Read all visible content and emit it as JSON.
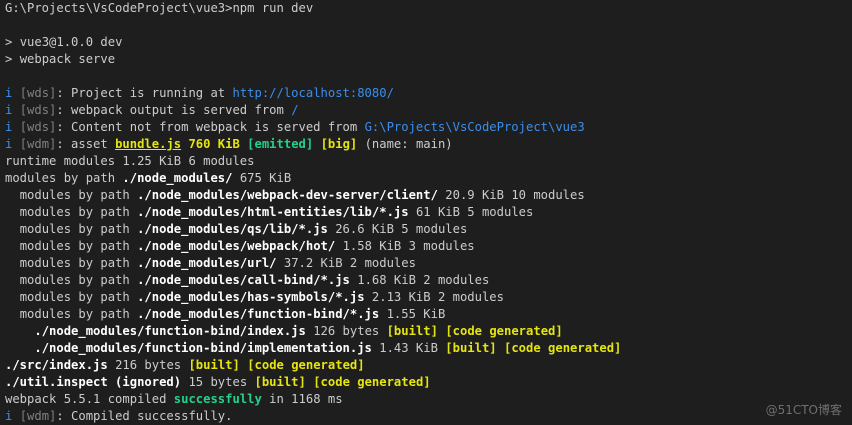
{
  "command": {
    "prompt": "G:\\Projects\\VsCodeProject\\vue3>",
    "text": "npm run dev"
  },
  "npm": [
    {
      "mark": "> ",
      "text": "vue3@1.0.0 dev"
    },
    {
      "mark": "> ",
      "text": "webpack serve"
    }
  ],
  "wds": {
    "info_icon": "i",
    "tag_wds": "[wds]",
    "tag_wdm": "[wdm]",
    "running_label": ": Project is running at ",
    "running_url": "http://localhost:8080/",
    "output_label": ": webpack output is served from ",
    "output_path": "/",
    "content_label": ": Content not from webpack is served from ",
    "content_path": "G:\\Projects\\VsCodeProject\\vue3"
  },
  "asset": {
    "prefix": ": asset ",
    "file": "bundle.js",
    "size": " 760 KiB ",
    "emitted": "[emitted]",
    "big": "[big]",
    "suffix": " (name: main)"
  },
  "summary": {
    "runtime": {
      "label": "runtime modules",
      "value": "1.25 KiB 6 modules"
    },
    "modules_root": {
      "label": "modules by path",
      "path": "./node_modules/",
      "value": "675 KiB"
    },
    "module_groups": [
      {
        "label": "modules by path",
        "path": "./node_modules/webpack-dev-server/client/",
        "value": "20.9 KiB 10 modules"
      },
      {
        "label": "modules by path",
        "path": "./node_modules/html-entities/lib/*.js",
        "value": "61 KiB 5 modules"
      },
      {
        "label": "modules by path",
        "path": "./node_modules/qs/lib/*.js",
        "value": "26.6 KiB 5 modules"
      },
      {
        "label": "modules by path",
        "path": "./node_modules/webpack/hot/",
        "value": "1.58 KiB 3 modules"
      },
      {
        "label": "modules by path",
        "path": "./node_modules/url/",
        "value": "37.2 KiB 2 modules"
      },
      {
        "label": "modules by path",
        "path": "./node_modules/call-bind/*.js",
        "value": "1.68 KiB 2 modules"
      },
      {
        "label": "modules by path",
        "path": "./node_modules/has-symbols/*.js",
        "value": "2.13 KiB 2 modules"
      },
      {
        "label": "modules by path",
        "path": "./node_modules/function-bind/*.js",
        "value": "1.55 KiB"
      }
    ],
    "files": [
      {
        "path": "./node_modules/function-bind/index.js",
        "size": "126 bytes"
      },
      {
        "path": "./node_modules/function-bind/implementation.js",
        "size": "1.43 KiB"
      },
      {
        "path": "./src/index.js",
        "size": "216 bytes"
      },
      {
        "path": "./util.inspect (ignored)",
        "size": "15 bytes"
      }
    ],
    "built": "[built]",
    "code_generated": "[code generated]"
  },
  "compile": {
    "prefix": "webpack 5.5.1 compiled ",
    "status": "successfully",
    "suffix": " in 1168 ms"
  },
  "final": {
    "text": ": Compiled successfully."
  },
  "watermark": "@51CTO博客",
  "colors": {
    "background": "#1e1e1e",
    "foreground": "#cccccc",
    "info_blue": "#3b8eea",
    "yellow": "#e5e510",
    "green": "#23d18b"
  }
}
